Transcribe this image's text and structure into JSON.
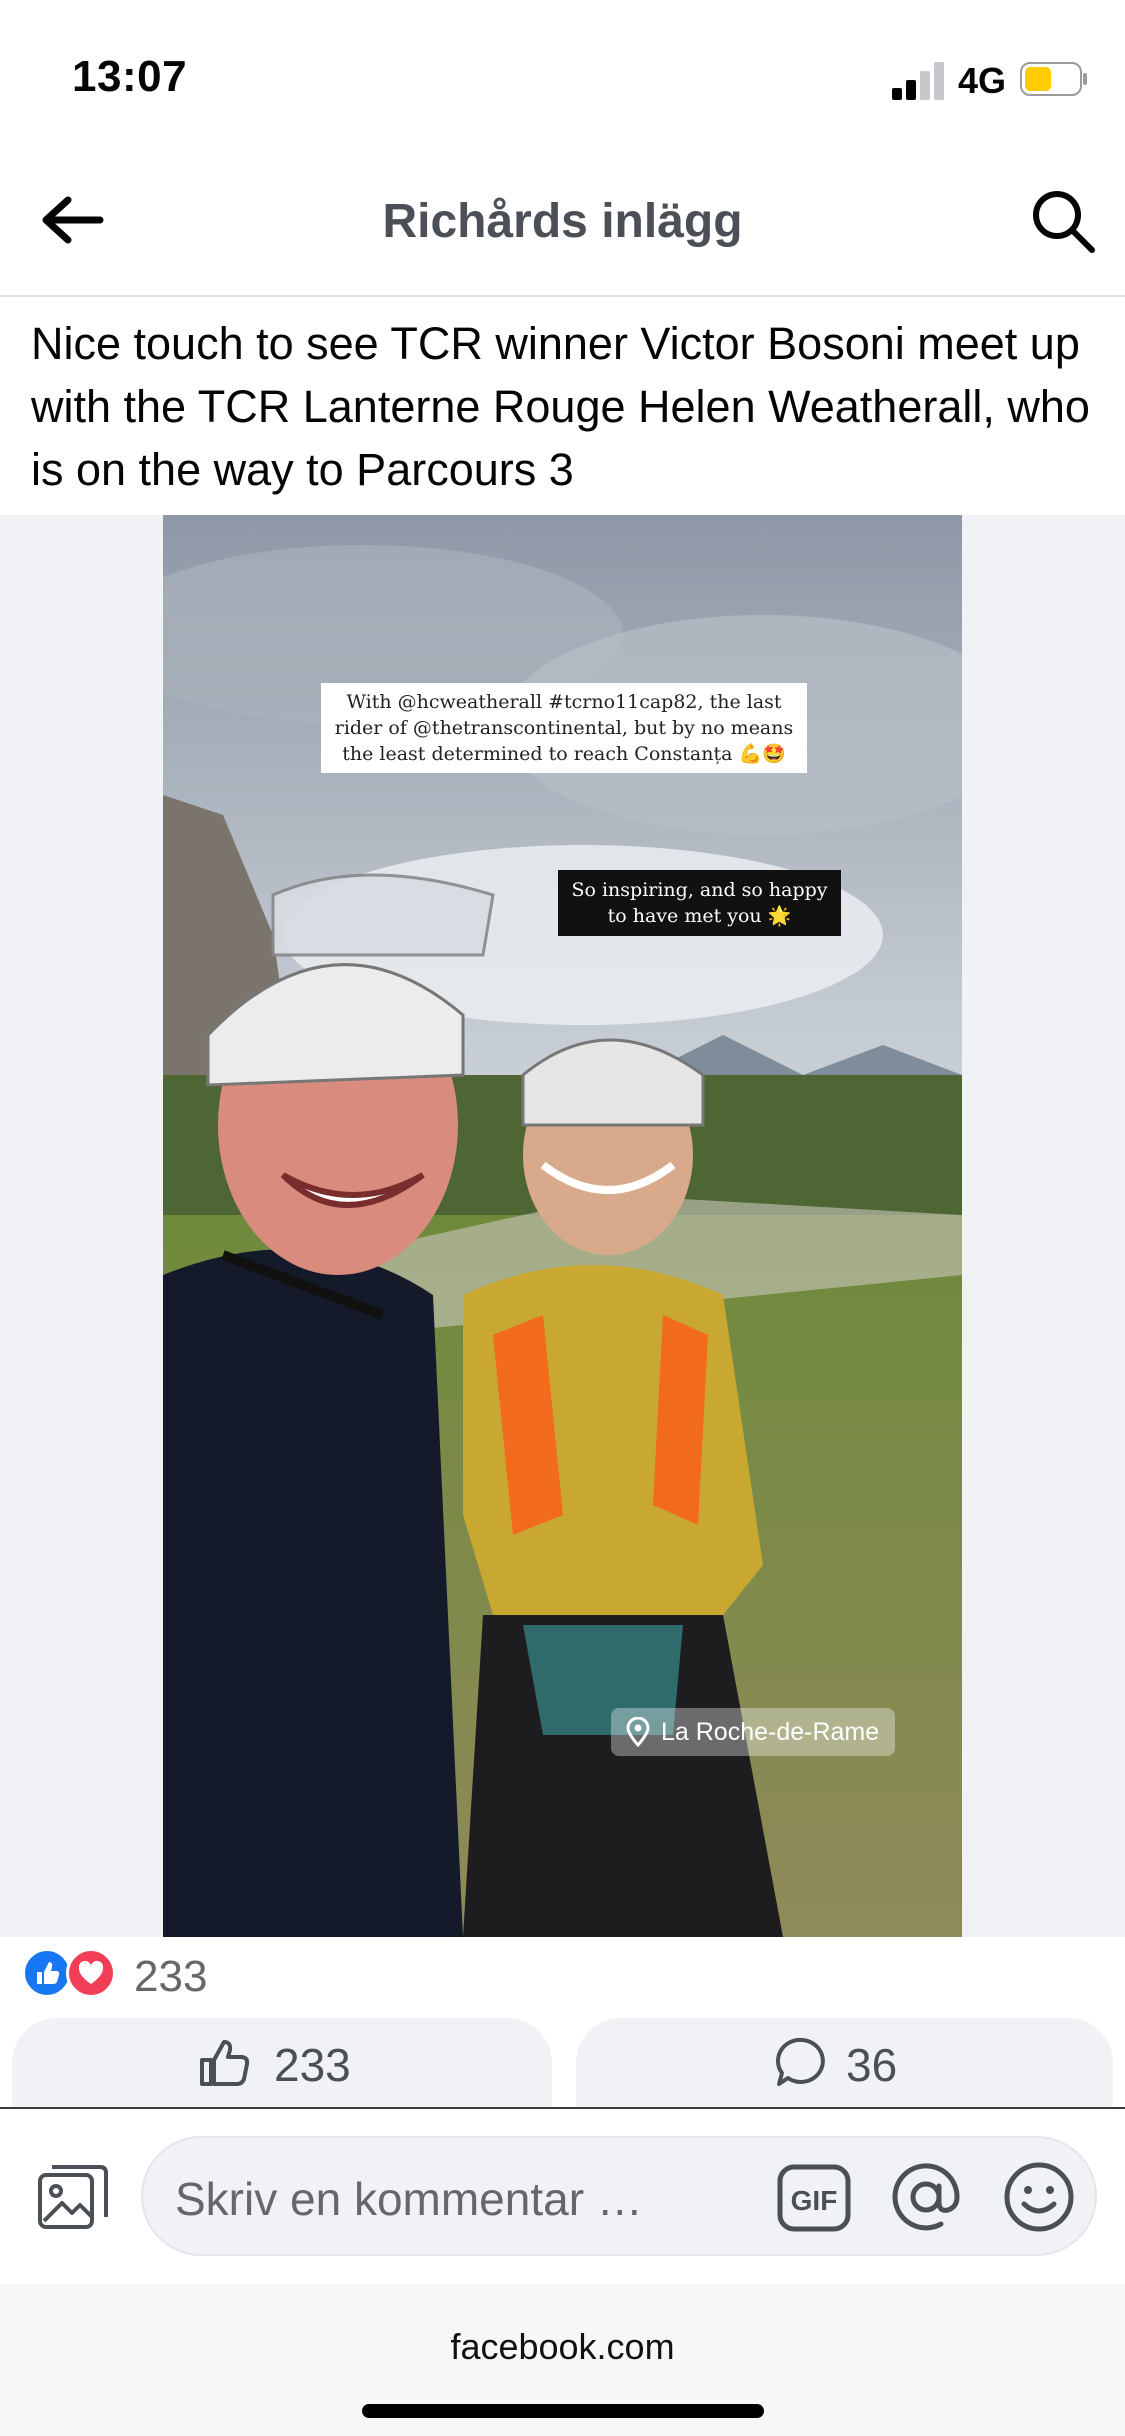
{
  "status_bar": {
    "time": "13:07",
    "network": "4G",
    "battery_color": "#ffcc00",
    "signal_bars": 2
  },
  "header": {
    "title": "Richårds inlägg",
    "back_icon": "back-arrow-icon",
    "search_icon": "search-icon"
  },
  "post": {
    "text": "Nice touch to see TCR winner Victor Bosoni meet up with the TCR Lanterne Rouge Helen Weatherall, who is on the way to Parcours 3",
    "image": {
      "caption_top": "With @hcweatherall #tcrno11cap82, the last rider of @thetranscontinental, but by no means the least determined to reach Constanța 💪🤩",
      "caption_bottom": "So inspiring, and so happy to have met you 🌟",
      "location": "La Roche-de-Rame"
    }
  },
  "reactions": {
    "count": "233",
    "types": [
      "like",
      "love"
    ]
  },
  "actions": {
    "like_count": "233",
    "comment_count": "36"
  },
  "composer": {
    "placeholder": "Skriv en kommentar …",
    "gif_label": "GIF"
  },
  "browser": {
    "url": "facebook.com"
  },
  "colors": {
    "like_blue": "#1877f2",
    "love_red": "#f33e58",
    "title_gray": "#4b4f56",
    "surface": "#f0f2f5"
  }
}
